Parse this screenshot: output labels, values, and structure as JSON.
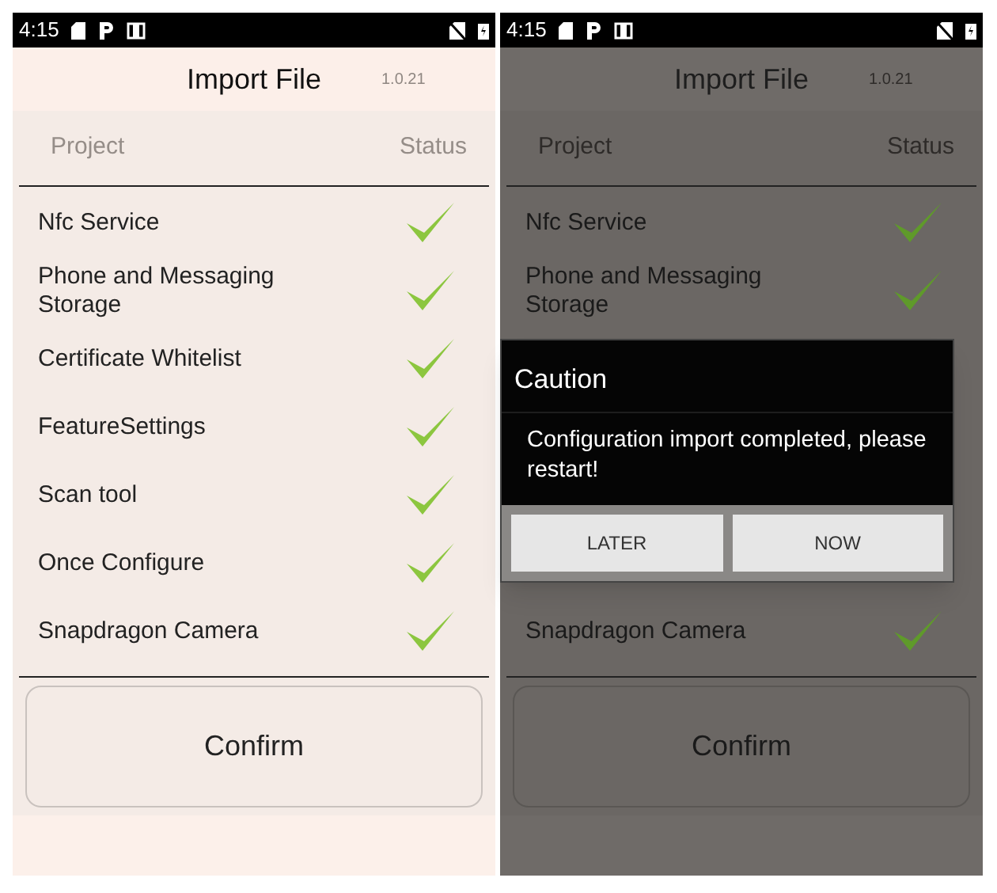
{
  "screens": [
    {
      "dimmed": false,
      "status_bar": {
        "time": "4:15"
      },
      "title": "Import File",
      "version": "1.0.21",
      "header": {
        "project": "Project",
        "status": "Status"
      },
      "rows_above": [
        {
          "name": "Nfc Service",
          "checked": true
        },
        {
          "name": "Phone and Messaging Storage",
          "checked": true
        },
        {
          "name": "Certificate Whitelist",
          "checked": true
        },
        {
          "name": "FeatureSettings",
          "checked": true
        },
        {
          "name": "Scan tool",
          "checked": true
        },
        {
          "name": "Once Configure",
          "checked": true
        },
        {
          "name": "Snapdragon Camera",
          "checked": true
        }
      ],
      "confirm": "Confirm"
    },
    {
      "dimmed": true,
      "status_bar": {
        "time": "4:15"
      },
      "title": "Import File",
      "version": "1.0.21",
      "header": {
        "project": "Project",
        "status": "Status"
      },
      "rows_above": [
        {
          "name": "Nfc Service",
          "checked": true
        },
        {
          "name": "Phone and Messaging Storage",
          "checked": true
        }
      ],
      "dialog": {
        "title": "Caution",
        "message": "Configuration import completed, please restart!",
        "buttons": [
          "LATER",
          "NOW"
        ]
      },
      "rows_below": [
        {
          "name": "Snapdragon Camera",
          "checked": true
        }
      ],
      "confirm": "Confirm"
    }
  ]
}
